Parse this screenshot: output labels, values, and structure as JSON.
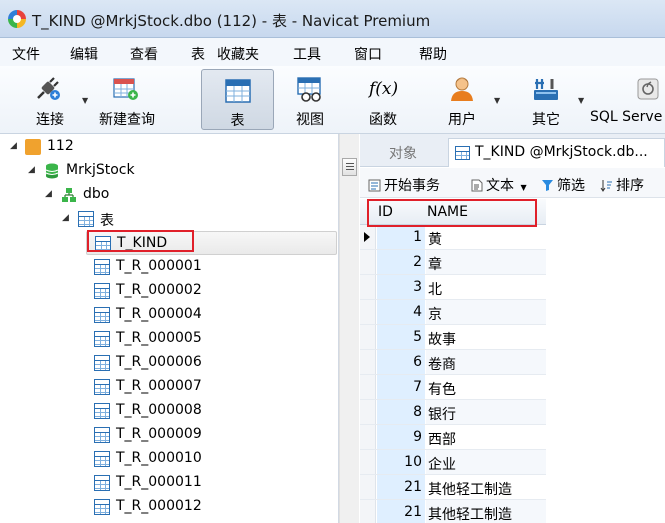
{
  "window": {
    "title": "T_KIND @MrkjStock.dbo (112) - 表 - Navicat Premium"
  },
  "menu": [
    "文件",
    "编辑",
    "查看",
    "表",
    "收藏夹",
    "工具",
    "窗口",
    "帮助"
  ],
  "toolbar": {
    "connect": "连接",
    "new_query": "新建查询",
    "table": "表",
    "view": "视图",
    "function": "函数",
    "function_icon_text": "f(x)",
    "user": "用户",
    "others": "其它",
    "sql_server": "SQL Serve"
  },
  "tree": {
    "server": "112",
    "database": "MrkjStock",
    "schema": "dbo",
    "tables_folder": "表",
    "tables": [
      "T_KIND",
      "T_R_000001",
      "T_R_000002",
      "T_R_000004",
      "T_R_000005",
      "T_R_000006",
      "T_R_000007",
      "T_R_000008",
      "T_R_000009",
      "T_R_000010",
      "T_R_000011",
      "T_R_000012"
    ],
    "selected_table": "T_KIND"
  },
  "tabs": {
    "objects": "对象",
    "active": "T_KIND @MrkjStock.db..."
  },
  "subtoolbar": {
    "begin_transaction": "开始事务",
    "text": "文本",
    "filter": "筛选",
    "sort": "排序"
  },
  "grid": {
    "columns": [
      "ID",
      "NAME"
    ],
    "rows": [
      {
        "id": "1",
        "name": "黄"
      },
      {
        "id": "2",
        "name": "章"
      },
      {
        "id": "3",
        "name": "北"
      },
      {
        "id": "4",
        "name": "京"
      },
      {
        "id": "5",
        "name": "故事"
      },
      {
        "id": "6",
        "name": "卷商"
      },
      {
        "id": "7",
        "name": "有色"
      },
      {
        "id": "8",
        "name": "银行"
      },
      {
        "id": "9",
        "name": "西部"
      },
      {
        "id": "10",
        "name": "企业"
      },
      {
        "id": "21",
        "name": "其他轻工制造"
      },
      {
        "id": "21",
        "name": "其他轻工制造"
      }
    ]
  },
  "colors": {
    "highlight": "#e0202a",
    "accent": "#2a6fb3",
    "id_column_bg": "#dfefff"
  }
}
